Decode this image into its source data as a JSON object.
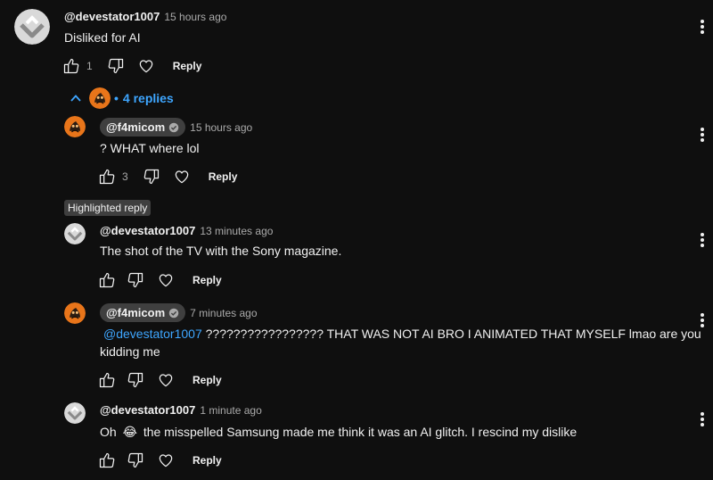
{
  "top_comment": {
    "author": "@devestator1007",
    "time": "15 hours ago",
    "text": "Disliked for AI",
    "likes": "1",
    "reply_label": "Reply"
  },
  "replies_toggle": {
    "label": "4 replies",
    "separator": "•"
  },
  "highlight_badge": "Highlighted reply",
  "replies": [
    {
      "author": "@f4micom",
      "verified": true,
      "time": "15 hours ago",
      "text": "?  WHAT where lol",
      "likes": "3",
      "reply_label": "Reply"
    },
    {
      "author": "@devestator1007",
      "verified": false,
      "time": "13 minutes ago",
      "text": "The shot of the TV with the Sony magazine.",
      "likes": "",
      "reply_label": "Reply"
    },
    {
      "author": "@f4micom",
      "verified": true,
      "time": "7 minutes ago",
      "mention": "@devestator1007",
      "text_line1": " ????????????????? THAT WAS NOT AI BRO I ANIMATED THAT MYSELF lmao are you",
      "text_line2": "kidding me",
      "likes": "",
      "reply_label": "Reply"
    },
    {
      "author": "@devestator1007",
      "verified": false,
      "time": "1 minute ago",
      "text_before_emoji": "Oh",
      "emoji": "😂",
      "text_after_emoji": "the misspelled Samsung made me think it was an AI glitch. I rescind my dislike",
      "likes": "",
      "reply_label": "Reply"
    }
  ],
  "colors": {
    "background": "#0f0f0f",
    "text": "#f1f1f1",
    "secondary": "#aaaaaa",
    "link": "#3ea6ff",
    "pill": "#3f3f3f",
    "avatar_orange": "#e8751a"
  },
  "icons": {
    "like": "thumbs-up-icon",
    "dislike": "thumbs-down-icon",
    "heart": "heart-outline-icon",
    "more": "more-vert-icon",
    "collapse": "chevron-up-icon",
    "verified": "verified-check-icon"
  }
}
